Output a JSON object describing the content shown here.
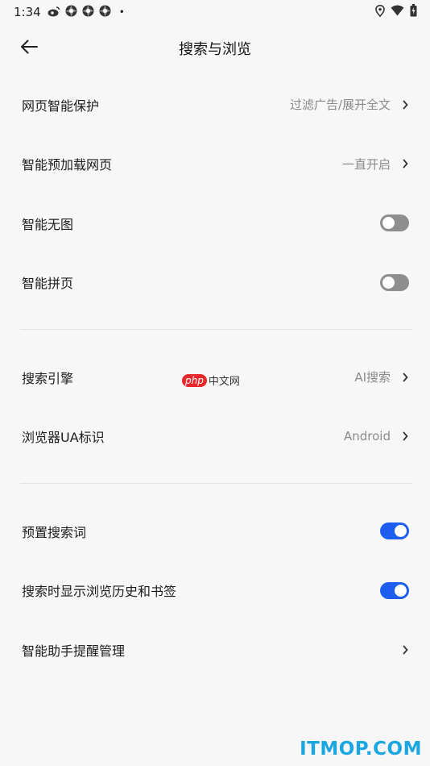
{
  "status_bar": {
    "time": "1:34",
    "left_icons": [
      "weibo-icon",
      "app-icon",
      "app-icon",
      "app-icon"
    ],
    "dot": "•",
    "right_icons": [
      "location-icon",
      "wifi-icon",
      "battery-icon"
    ]
  },
  "header": {
    "title": "搜索与浏览",
    "back_icon": "arrow-left-icon"
  },
  "section1": [
    {
      "label": "网页智能保护",
      "value": "过滤广告/展开全文",
      "type": "link"
    },
    {
      "label": "智能预加载网页",
      "value": "一直开启",
      "type": "link"
    },
    {
      "label": "智能无图",
      "type": "toggle",
      "on": false
    },
    {
      "label": "智能拼页",
      "type": "toggle",
      "on": false
    }
  ],
  "section2": [
    {
      "label": "搜索引擎",
      "value": "AI搜索",
      "type": "link"
    },
    {
      "label": "浏览器UA标识",
      "value": "Android",
      "type": "link"
    }
  ],
  "section3": [
    {
      "label": "预置搜索词",
      "type": "toggle",
      "on": true
    },
    {
      "label": "搜索时显示浏览历史和书签",
      "type": "toggle",
      "on": true
    },
    {
      "label": "智能助手提醒管理",
      "type": "link"
    }
  ],
  "watermarks": {
    "php_badge": "php",
    "php_text": "中文网",
    "bottom": "ITMOP.COM"
  },
  "colors": {
    "background": "#f7f7f7",
    "toggle_on": "#1e5eef",
    "toggle_off": "#8e8e8e",
    "value_text": "#8a8a8a",
    "watermark": "#1aa6e0"
  }
}
